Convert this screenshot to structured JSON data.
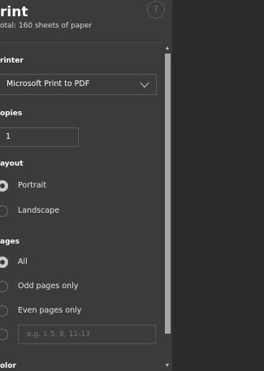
{
  "header": {
    "title": "rint",
    "subtitle": "otal: 160 sheets of paper",
    "help_label": "?"
  },
  "printer": {
    "label": "rinter",
    "selected": "Microsoft Print to PDF"
  },
  "copies": {
    "label": "opies",
    "value": "1"
  },
  "layout": {
    "label": "ayout",
    "options": [
      "Portrait",
      "Landscape"
    ],
    "selected": "Portrait"
  },
  "pages": {
    "label": "ages",
    "options": [
      "All",
      "Odd pages only",
      "Even pages only"
    ],
    "selected": "All",
    "range_placeholder": "e.g. 1-5, 8, 11-13"
  },
  "color": {
    "label": "olor"
  },
  "colors": {
    "panel_bg": "#3b3b3b",
    "preview_bg": "#2b2b2b"
  }
}
